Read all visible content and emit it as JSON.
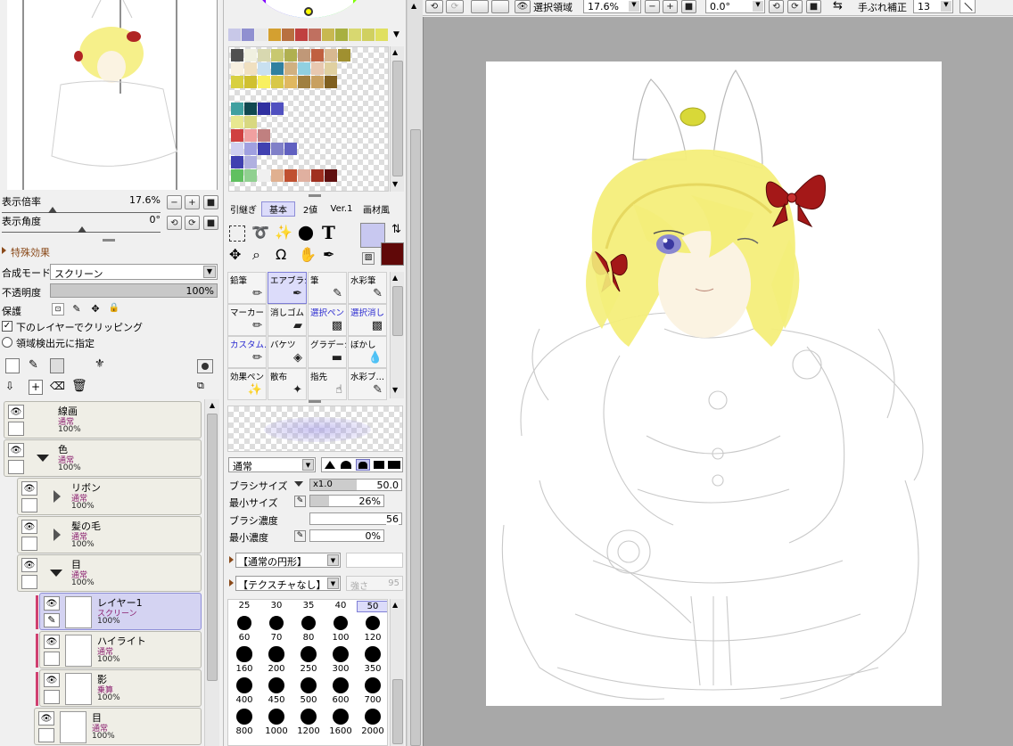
{
  "navigator": {
    "zoom_label": "表示倍率",
    "zoom_value": "17.6%",
    "angle_label": "表示角度",
    "angle_value": "0°"
  },
  "layer_panel": {
    "section_title": "特殊効果",
    "blend_label": "合成モード",
    "blend_value": "スクリーン",
    "opacity_label": "不透明度",
    "opacity_value": "100%",
    "opacity_fraction": 1.0,
    "protect_label": "保護",
    "clip_label": "下のレイヤーでクリッピング",
    "clip_checked": true,
    "region_label": "領域検出元に指定",
    "layers": [
      {
        "name": "線画",
        "mode": "通常",
        "opacity": "100%",
        "kind": "layer-collapsed"
      },
      {
        "name": "色",
        "mode": "通常",
        "opacity": "100%",
        "kind": "folder-open"
      },
      {
        "name": "リボン",
        "mode": "通常",
        "opacity": "100%",
        "kind": "folder-closed"
      },
      {
        "name": "髪の毛",
        "mode": "通常",
        "opacity": "100%",
        "kind": "folder-closed"
      },
      {
        "name": "目",
        "mode": "通常",
        "opacity": "100%",
        "kind": "folder-open"
      },
      {
        "name": "レイヤー1",
        "mode": "スクリーン",
        "opacity": "100%",
        "kind": "layer",
        "selected": true
      },
      {
        "name": "ハイライト",
        "mode": "通常",
        "opacity": "100%",
        "kind": "layer"
      },
      {
        "name": "影",
        "mode": "乗算",
        "opacity": "100%",
        "kind": "layer"
      },
      {
        "name": "目",
        "mode": "通常",
        "opacity": "100%",
        "kind": "layer"
      }
    ]
  },
  "color_panel": {
    "palette_top": [
      "#c8c8e8",
      "#9090d0",
      "#e8e8e8",
      "#d4a030",
      "#b87040",
      "#c04040",
      "#c07060",
      "#c8b850",
      "#a8b040",
      "#d8d870",
      "#d0d060",
      "#e0e060"
    ],
    "swatch_rows": [
      [
        "#505050",
        "#f0f0e0",
        "#d8d8b0",
        "#c8c870",
        "#b0b050",
        "#c09878",
        "#c06040",
        "#d8b890",
        "#a09030"
      ],
      [
        "#f8f0e0",
        "#f0e0c0",
        "#c8e0f0",
        "#3080a0",
        "#d0b080",
        "#90d0e0",
        "#e8c8b0",
        "#e0d0a0"
      ],
      [
        "#d8d040",
        "#d0c030",
        "#f8f060",
        "#d8c848",
        "#e0b860",
        "#a08040",
        "#c8a060",
        "#806020"
      ],
      [],
      [
        "#40a0a0",
        "#104850",
        "#3030a0",
        "#5050c0"
      ],
      [
        "#e8e890",
        "#d8d880"
      ],
      [
        "#d04040",
        "#f0a0a0",
        "#c08080"
      ],
      [
        "#d0d0f0",
        "#a0a0e0",
        "#4040b0",
        "#8080c8",
        "#6060c0"
      ],
      [
        "#4040b0",
        "#b0b0e0"
      ],
      [
        "#60c060",
        "#90d090",
        "#f0f0f0",
        "#e0b090",
        "#c05030",
        "#e0b0a0",
        "#a03020",
        "#601010"
      ]
    ],
    "fg_color": "#c8c8f0",
    "bg_color": "#600808"
  },
  "brush_tabs": [
    "引継ぎ",
    "基本",
    "2値",
    "Ver.1",
    "画材風"
  ],
  "brush_tab_selected": 1,
  "tools": [
    {
      "label": "鉛筆",
      "icon": "pencil-icon",
      "glyph": "✏"
    },
    {
      "label": "エアブラシ",
      "icon": "airbrush-icon",
      "glyph": "✒",
      "selected": true
    },
    {
      "label": "筆",
      "icon": "brush-icon",
      "glyph": "✎"
    },
    {
      "label": "水彩筆",
      "icon": "watercolor-brush-icon",
      "glyph": "✎"
    },
    {
      "label": "マーカー",
      "icon": "marker-icon",
      "glyph": "✏"
    },
    {
      "label": "消しゴム",
      "icon": "eraser-icon",
      "glyph": "▰"
    },
    {
      "label": "選択ペン",
      "icon": "select-pen-icon",
      "glyph": "▩",
      "blue": true
    },
    {
      "label": "選択消し",
      "icon": "select-erase-icon",
      "glyph": "▩",
      "blue": true
    },
    {
      "label": "カスタム…",
      "icon": "custom-brush-icon",
      "glyph": "✏",
      "blue": true
    },
    {
      "label": "バケツ",
      "icon": "bucket-icon",
      "glyph": "◈"
    },
    {
      "label": "グラデーション",
      "icon": "gradient-icon",
      "glyph": "▬"
    },
    {
      "label": "ぼかし",
      "icon": "blur-icon",
      "glyph": "💧"
    },
    {
      "label": "効果ペン",
      "icon": "effect-pen-icon",
      "glyph": "✨"
    },
    {
      "label": "散布",
      "icon": "scatter-icon",
      "glyph": "✦"
    },
    {
      "label": "指先",
      "icon": "finger-icon",
      "glyph": "☝"
    },
    {
      "label": "水彩ブ…",
      "icon": "watercolor-icon",
      "glyph": "✎"
    }
  ],
  "brush_settings": {
    "blend_mode": "通常",
    "size_label": "ブラシサイズ",
    "size_mult": "x1.0",
    "size_value": "50.0",
    "min_size_label": "最小サイズ",
    "min_size_value": "26%",
    "min_size_fraction": 0.26,
    "density_label": "ブラシ濃度",
    "density_value": "56",
    "min_density_label": "最小濃度",
    "min_density_value": "0%",
    "shape_label": "【通常の円形】",
    "texture_label": "【テクスチャなし】",
    "strength_label": "強さ",
    "strength_value": "95"
  },
  "brush_sizes": [
    {
      "v": "25"
    },
    {
      "v": "30"
    },
    {
      "v": "35"
    },
    {
      "v": "40"
    },
    {
      "v": "50",
      "selected": true
    },
    {
      "v": "60"
    },
    {
      "v": "70"
    },
    {
      "v": "80"
    },
    {
      "v": "100"
    },
    {
      "v": "120"
    },
    {
      "v": "160"
    },
    {
      "v": "200"
    },
    {
      "v": "250"
    },
    {
      "v": "300"
    },
    {
      "v": "350"
    },
    {
      "v": "400"
    },
    {
      "v": "450"
    },
    {
      "v": "500"
    },
    {
      "v": "600"
    },
    {
      "v": "700"
    },
    {
      "v": "800"
    },
    {
      "v": "1000"
    },
    {
      "v": "1200"
    },
    {
      "v": "1600"
    },
    {
      "v": "2000"
    }
  ],
  "toolbar": {
    "selection_label": "選択領域",
    "zoom_value": "17.6%",
    "angle_value": "0.0°",
    "stabilizer_label": "手ぶれ補正",
    "stabilizer_value": "13"
  }
}
